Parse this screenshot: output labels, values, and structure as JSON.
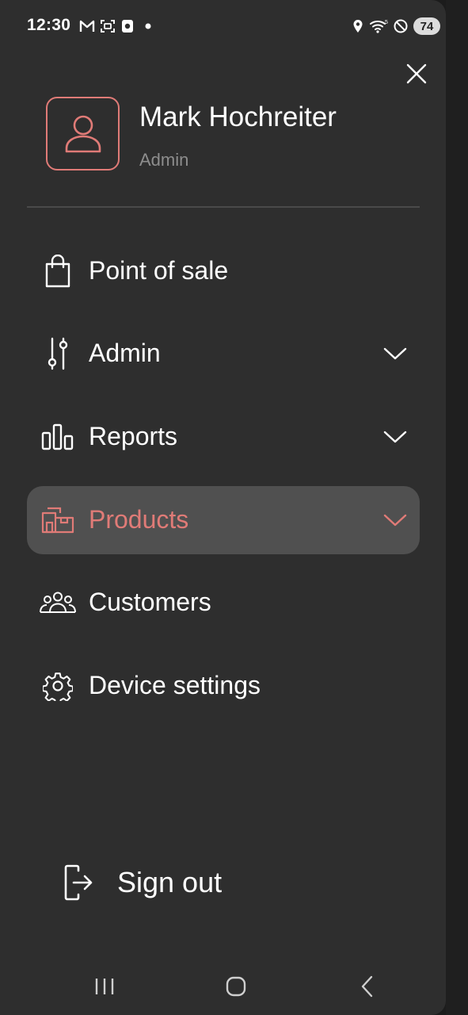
{
  "status_bar": {
    "time": "12:30",
    "battery": "74",
    "icons": [
      "gmail-icon",
      "screenshot-icon",
      "app-notification-icon",
      "dot-icon",
      "location-icon",
      "wifi-icon",
      "do-not-disturb-icon"
    ]
  },
  "profile": {
    "name": "Mark Hochreiter",
    "role": "Admin"
  },
  "menu": {
    "items": [
      {
        "label": "Point of sale",
        "icon": "shopping-bag-icon",
        "expandable": false
      },
      {
        "label": "Admin",
        "icon": "sliders-icon",
        "expandable": true
      },
      {
        "label": "Reports",
        "icon": "bar-chart-icon",
        "expandable": true
      },
      {
        "label": "Products",
        "icon": "products-box-icon",
        "expandable": true,
        "active": true
      },
      {
        "label": "Customers",
        "icon": "users-icon",
        "expandable": false
      },
      {
        "label": "Device settings",
        "icon": "gear-icon",
        "expandable": false
      }
    ]
  },
  "sign_out": {
    "label": "Sign out",
    "icon": "sign-out-icon"
  },
  "nav": {
    "buttons": [
      "recent-apps-icon",
      "home-icon",
      "back-icon"
    ]
  },
  "colors": {
    "accent": "#e07b77",
    "drawer_bg": "#2e2e2e",
    "active_bg": "#505050",
    "text": "#ffffff",
    "muted": "#8d8d8d"
  }
}
